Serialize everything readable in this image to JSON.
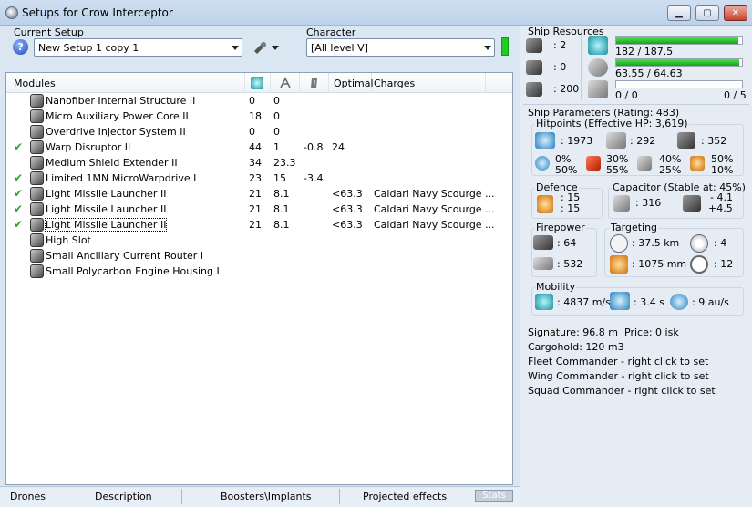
{
  "window": {
    "title": "Setups for Crow Interceptor",
    "minimize": "▁",
    "maximize": "▢",
    "close": "✕"
  },
  "left": {
    "current_setup_label": "Current Setup",
    "current_setup_value": "New Setup 1 copy 1",
    "character_label": "Character",
    "character_value": "[All level V]",
    "help_glyph": "?"
  },
  "modules_table": {
    "headers": {
      "modules": "Modules",
      "optimal": "Optimal",
      "charges": "Charges"
    },
    "rows": [
      {
        "check": "",
        "name": "Nanofiber Internal Structure II",
        "c1": "0",
        "c2": "0",
        "c3": "",
        "optimal": "",
        "charges": ""
      },
      {
        "check": "",
        "name": "Micro Auxiliary Power Core II",
        "c1": "18",
        "c2": "0",
        "c3": "",
        "optimal": "",
        "charges": ""
      },
      {
        "check": "",
        "name": "Overdrive Injector System II",
        "c1": "0",
        "c2": "0",
        "c3": "",
        "optimal": "",
        "charges": ""
      },
      {
        "check": "✔",
        "name": "Warp Disruptor II",
        "c1": "44",
        "c2": "1",
        "c3": "-0.8",
        "optimal": "24",
        "charges": ""
      },
      {
        "check": "",
        "name": "Medium Shield Extender II",
        "c1": "34",
        "c2": "23.3",
        "c3": "",
        "optimal": "",
        "charges": ""
      },
      {
        "check": "✔",
        "name": "Limited 1MN MicroWarpdrive I",
        "c1": "23",
        "c2": "15",
        "c3": "-3.4",
        "optimal": "",
        "charges": ""
      },
      {
        "check": "✔",
        "name": "Light Missile Launcher II",
        "c1": "21",
        "c2": "8.1",
        "c3": "",
        "optimal": "<63.3",
        "charges": "Caldari Navy Scourge ..."
      },
      {
        "check": "✔",
        "name": "Light Missile Launcher II",
        "c1": "21",
        "c2": "8.1",
        "c3": "",
        "optimal": "<63.3",
        "charges": "Caldari Navy Scourge ..."
      },
      {
        "check": "✔",
        "name": "Light Missile Launcher II",
        "c1": "21",
        "c2": "8.1",
        "c3": "",
        "optimal": "<63.3",
        "charges": "Caldari Navy Scourge ..."
      },
      {
        "check": "",
        "name": "High Slot",
        "c1": "",
        "c2": "",
        "c3": "",
        "optimal": "",
        "charges": ""
      },
      {
        "check": "",
        "name": "Small Ancillary Current Router I",
        "c1": "",
        "c2": "",
        "c3": "",
        "optimal": "",
        "charges": ""
      },
      {
        "check": "",
        "name": "Small Polycarbon Engine Housing I",
        "c1": "",
        "c2": "",
        "c3": "",
        "optimal": "",
        "charges": ""
      }
    ]
  },
  "bottom_tabs": {
    "drones": "Drones",
    "description": "Description",
    "boosters": "Boosters\\Implants",
    "projected": "Projected effects",
    "stats": "Stats"
  },
  "resources": {
    "title": "Ship Resources",
    "hardpoints_a": ": 2",
    "hardpoints_b": ": 0",
    "calibration": ": 200",
    "cpu_text": "182 / 187.5",
    "cpu_fraction": 0.97,
    "power_text": "63.55 / 64.63",
    "power_fraction": 0.98,
    "drone_bay_text": "0 / 0",
    "drone_bw_text": "0 / 5",
    "drone_fraction": 0
  },
  "parameters": {
    "title": "Ship Parameters (Rating: 483)",
    "hitpoints_title": "Hitpoints (Effective HP: 3,619)",
    "shield_hp": ": 1973",
    "armor_hp": ": 292",
    "hull_hp": ": 352",
    "res_em_a": "0%",
    "res_em_b": "50%",
    "res_th_a": "30%",
    "res_th_b": "55%",
    "res_ki_a": "40%",
    "res_ki_b": "25%",
    "res_ex_a": "50%",
    "res_ex_b": "10%",
    "defence_title": "Defence",
    "defence_a": ": 15",
    "defence_b": ": 15",
    "capacitor_title": "Capacitor (Stable at: 45%)",
    "capacitor_value": ": 316",
    "cap_delta_a": "- 4.1",
    "cap_delta_b": "+4.5",
    "firepower_title": "Firepower",
    "fire_a": ": 64",
    "fire_b": ": 532",
    "targeting_title": "Targeting",
    "target_range": ": 37.5 km",
    "target_count": ": 4",
    "scan_res": ": 1075 mm",
    "sensor": ": 12",
    "mobility_title": "Mobility",
    "velocity": ": 4837 m/s",
    "align": ": 3.4 s",
    "warp": ": 9 au/s",
    "signature": "Signature: 96.8 m",
    "price": "Price: 0 isk",
    "cargohold": "Cargohold: 120 m3",
    "fleet": "Fleet Commander - right click to set",
    "wing": "Wing Commander - right click to set",
    "squad": "Squad Commander - right click to set"
  }
}
